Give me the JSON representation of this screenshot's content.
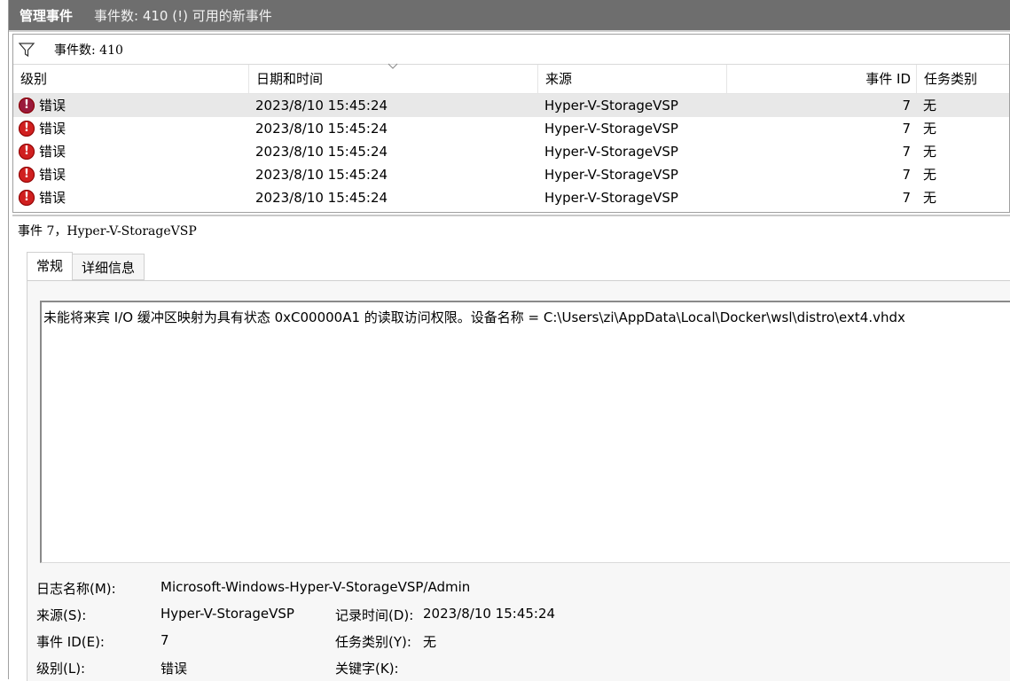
{
  "header": {
    "title": "管理事件",
    "subtitle": "事件数: 410 (!) 可用的新事件"
  },
  "filter": {
    "text": "事件数: 410",
    "icon": "filter-icon"
  },
  "columns": [
    "级别",
    "日期和时间",
    "来源",
    "事件 ID",
    "任务类别"
  ],
  "rows": [
    {
      "level": "错误",
      "datetime": "2023/8/10 15:45:24",
      "source": "Hyper-V-StorageVSP",
      "event_id": "7",
      "task": "无",
      "selected": true
    },
    {
      "level": "错误",
      "datetime": "2023/8/10 15:45:24",
      "source": "Hyper-V-StorageVSP",
      "event_id": "7",
      "task": "无",
      "selected": false
    },
    {
      "level": "错误",
      "datetime": "2023/8/10 15:45:24",
      "source": "Hyper-V-StorageVSP",
      "event_id": "7",
      "task": "无",
      "selected": false
    },
    {
      "level": "错误",
      "datetime": "2023/8/10 15:45:24",
      "source": "Hyper-V-StorageVSP",
      "event_id": "7",
      "task": "无",
      "selected": false
    },
    {
      "level": "错误",
      "datetime": "2023/8/10 15:45:24",
      "source": "Hyper-V-StorageVSP",
      "event_id": "7",
      "task": "无",
      "selected": false
    }
  ],
  "detail": {
    "title": "事件 7，Hyper-V-StorageVSP",
    "tabs": [
      "常规",
      "详细信息"
    ],
    "message": "未能将来宾 I/O 缓冲区映射为具有状态 0xC00000A1 的读取访问权限。设备名称 = C:\\Users\\zi\\AppData\\Local\\Docker\\wsl\\distro\\ext4.vhdx",
    "props": {
      "log_name_label": "日志名称(M):",
      "log_name_value": "Microsoft-Windows-Hyper-V-StorageVSP/Admin",
      "source_label": "来源(S):",
      "source_value": "Hyper-V-StorageVSP",
      "logged_label": "记录时间(D):",
      "logged_value": "2023/8/10 15:45:24",
      "event_id_label": "事件 ID(E):",
      "event_id_value": "7",
      "task_label": "任务类别(Y):",
      "task_value": "无",
      "level_label": "级别(L):",
      "level_value": "错误",
      "keywords_label": "关键字(K):"
    }
  },
  "colors": {
    "titlebar": "#6e6e6e",
    "error": "#d02020",
    "selected_row": "#e8e8e8"
  }
}
